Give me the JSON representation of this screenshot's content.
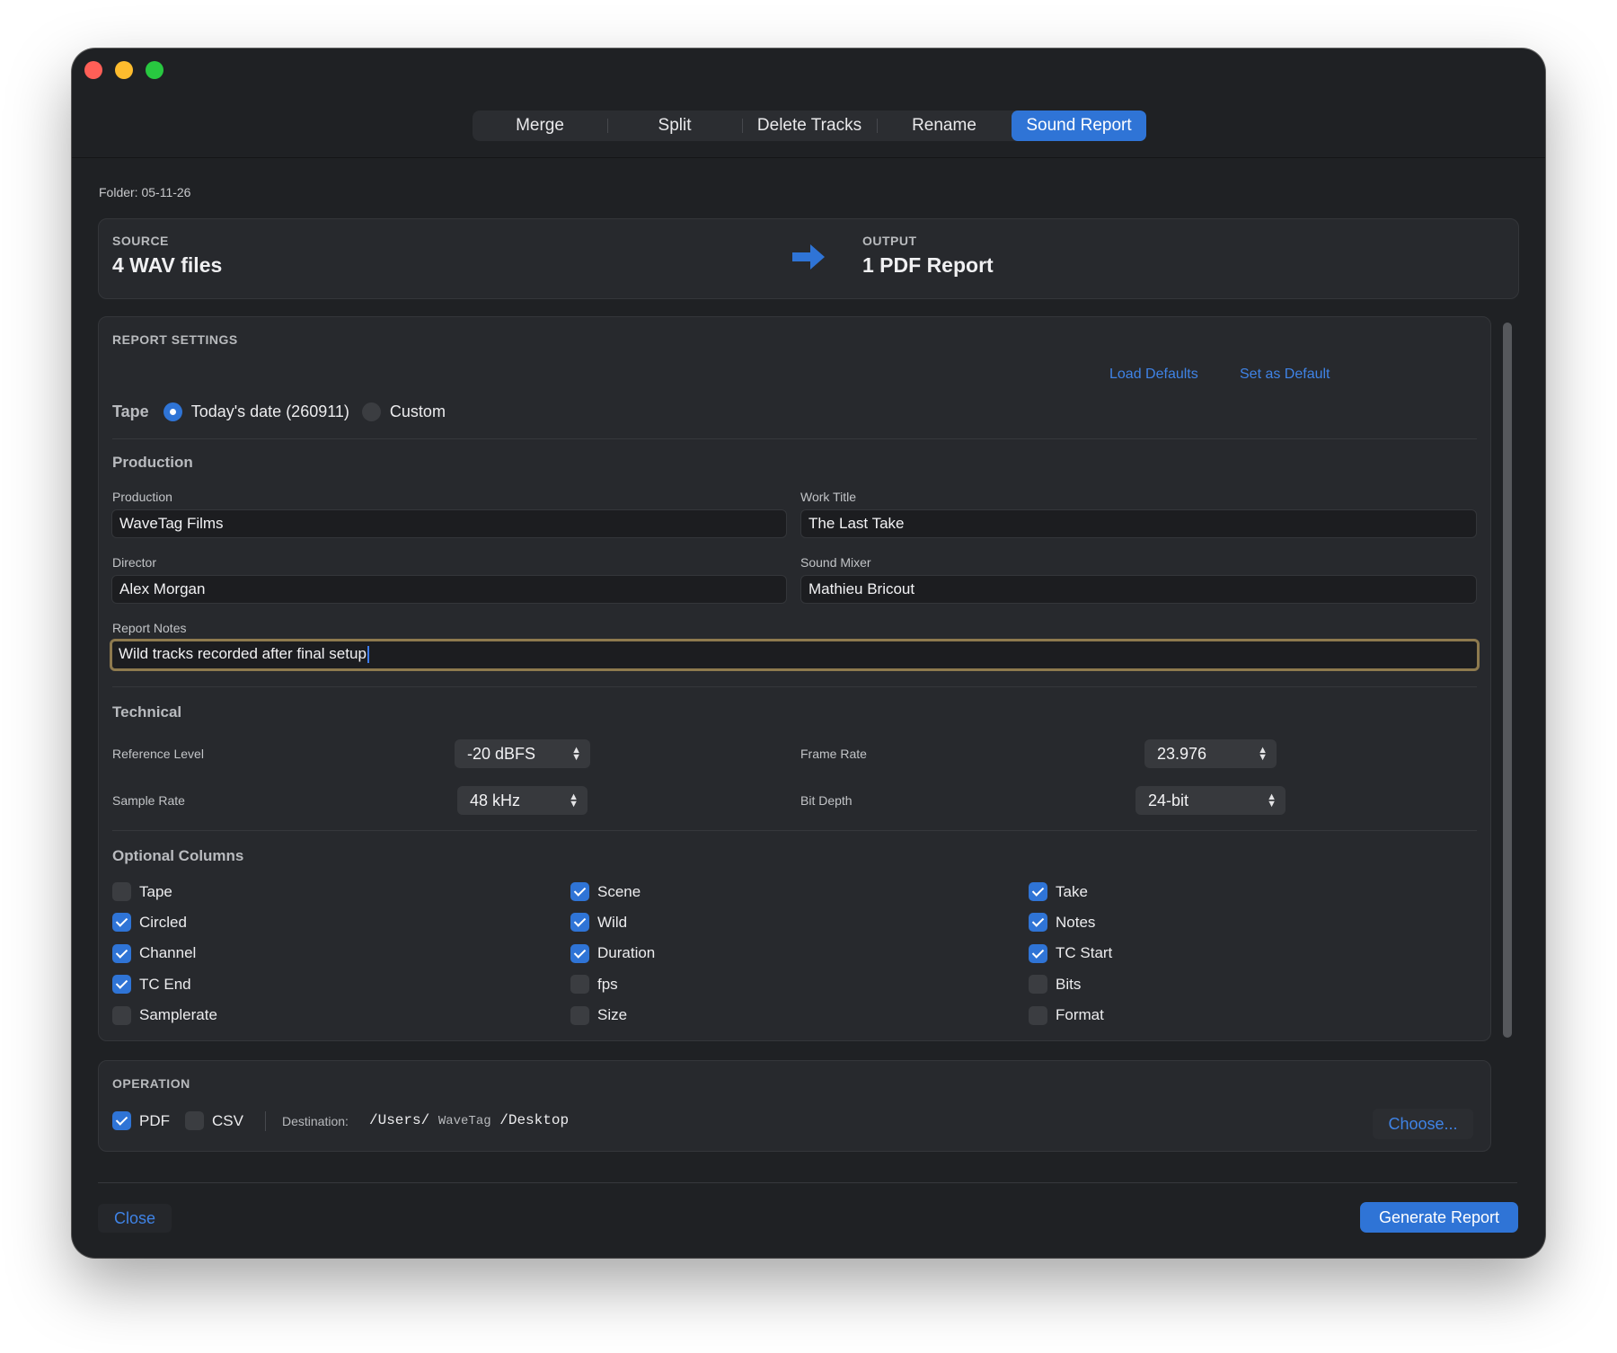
{
  "tabs": [
    {
      "label": "Merge",
      "active": false
    },
    {
      "label": "Split",
      "active": false
    },
    {
      "label": "Delete Tracks",
      "active": false
    },
    {
      "label": "Rename",
      "active": false
    },
    {
      "label": "Sound Report",
      "active": true
    }
  ],
  "folder_label": "Folder: 05-11-26",
  "source": {
    "caption": "SOURCE",
    "value": "4 WAV files"
  },
  "output": {
    "caption": "OUTPUT",
    "value": "1 PDF Report"
  },
  "report_settings": {
    "title": "REPORT SETTINGS",
    "load_defaults": "Load Defaults",
    "set_default": "Set as Default",
    "tape": {
      "label": "Tape",
      "options": [
        {
          "label": "Today's date (260911)",
          "selected": true
        },
        {
          "label": "Custom",
          "selected": false
        }
      ]
    },
    "production": {
      "title": "Production",
      "production_label": "Production",
      "production_value": "WaveTag Films",
      "work_title_label": "Work Title",
      "work_title_value": "The Last Take",
      "director_label": "Director",
      "director_value": "Alex Morgan",
      "sound_mixer_label": "Sound Mixer",
      "sound_mixer_value": "Mathieu Bricout",
      "notes_label": "Report Notes",
      "notes_value": "Wild tracks recorded after final setup"
    },
    "technical": {
      "title": "Technical",
      "reference_level_label": "Reference Level",
      "reference_level_value": "-20 dBFS",
      "frame_rate_label": "Frame Rate",
      "frame_rate_value": "23.976",
      "sample_rate_label": "Sample Rate",
      "sample_rate_value": "48 kHz",
      "bit_depth_label": "Bit Depth",
      "bit_depth_value": "24-bit"
    },
    "optional_columns": {
      "title": "Optional Columns",
      "items": [
        {
          "label": "Tape",
          "checked": false
        },
        {
          "label": "Scene",
          "checked": true
        },
        {
          "label": "Take",
          "checked": true
        },
        {
          "label": "Circled",
          "checked": true
        },
        {
          "label": "Wild",
          "checked": true
        },
        {
          "label": "Notes",
          "checked": true
        },
        {
          "label": "Channel",
          "checked": true
        },
        {
          "label": "Duration",
          "checked": true
        },
        {
          "label": "TC Start",
          "checked": true
        },
        {
          "label": "TC End",
          "checked": true
        },
        {
          "label": "fps",
          "checked": false
        },
        {
          "label": "Bits",
          "checked": false
        },
        {
          "label": "Samplerate",
          "checked": false
        },
        {
          "label": "Size",
          "checked": false
        },
        {
          "label": "Format",
          "checked": false
        }
      ]
    }
  },
  "operation": {
    "title": "OPERATION",
    "pdf_label": "PDF",
    "pdf_checked": true,
    "csv_label": "CSV",
    "csv_checked": false,
    "destination_label": "Destination:",
    "path_prefix": "/Users/",
    "path_user": "WaveTag",
    "path_suffix": "/Desktop",
    "choose_label": "Choose..."
  },
  "footer": {
    "close_label": "Close",
    "generate_label": "Generate Report"
  },
  "colors": {
    "accent": "#2f74d6",
    "link": "#3f83e6",
    "focus_ring": "#8e7a4e",
    "window_bg": "#1f2124"
  }
}
